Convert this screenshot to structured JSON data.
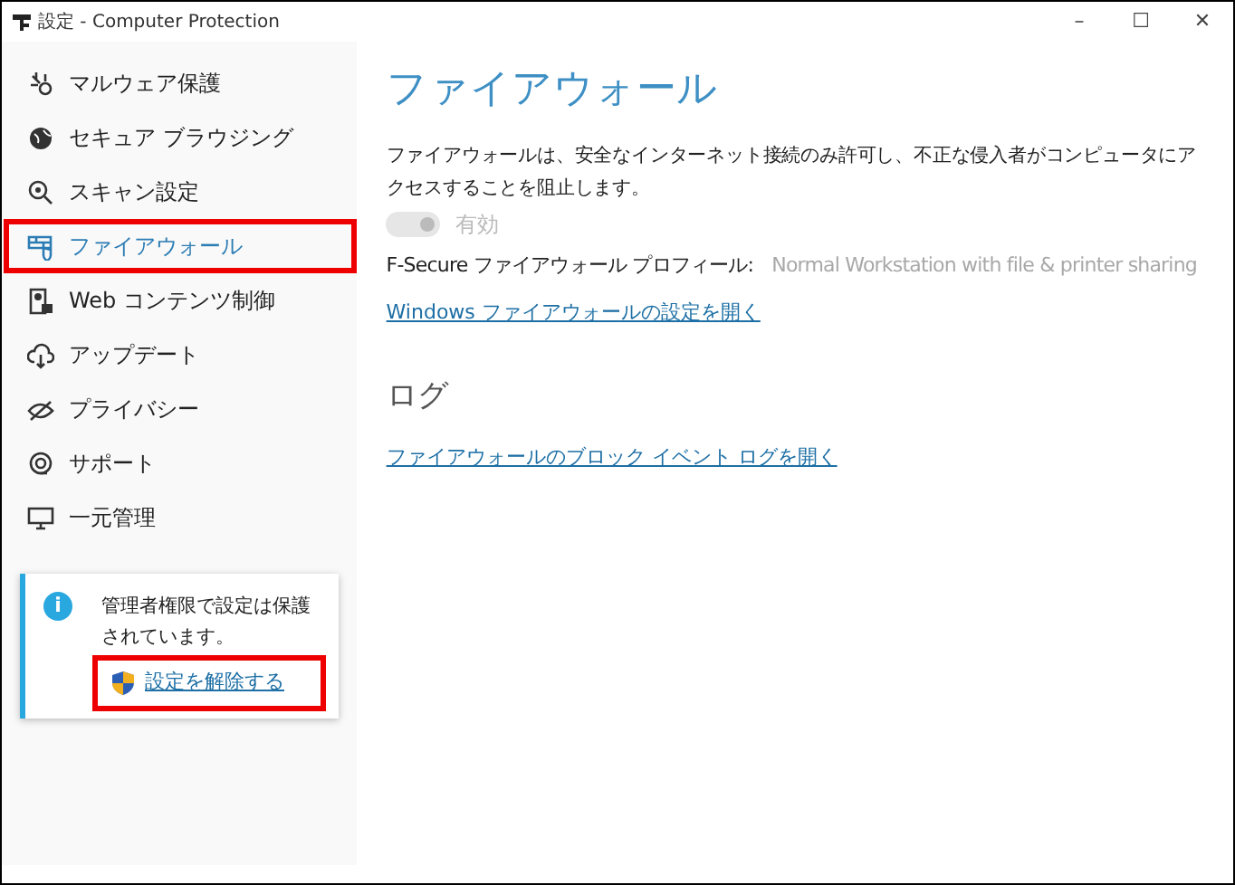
{
  "window": {
    "title": "設定 - Computer Protection",
    "controls": [
      "–",
      "☐",
      "✕"
    ]
  },
  "sidebar": {
    "items": [
      {
        "label": "マルウェア保護",
        "selected": false,
        "highlighted": false
      },
      {
        "label": "セキュア ブラウジング",
        "selected": false,
        "highlighted": false
      },
      {
        "label": "スキャン設定",
        "selected": false,
        "highlighted": false
      },
      {
        "label": "ファイアウォール",
        "selected": true,
        "highlighted": true
      },
      {
        "label": "Web コンテンツ制御",
        "selected": false,
        "highlighted": false
      },
      {
        "label": "アップデート",
        "selected": false,
        "highlighted": false
      },
      {
        "label": "プライバシー",
        "selected": false,
        "highlighted": false
      },
      {
        "label": "サポート",
        "selected": false,
        "highlighted": false
      },
      {
        "label": "一元管理",
        "selected": false,
        "highlighted": false
      }
    ],
    "notice": {
      "icon": "i",
      "text": "管理者権限で設定は保護されています。",
      "link": "設定を解除する",
      "highlighted": true
    }
  },
  "main": {
    "title": "ファイアウォール",
    "description": "ファイアウォールは、安全なインターネット接続のみ許可し、不正な侵入者がコンピュータにアクセスすることを阻止します。",
    "toggle": {
      "label": "有効",
      "on": true,
      "disabled": true
    },
    "profile": {
      "label": "F-Secure ファイアウォール プロフィール:",
      "value": "Normal Workstation with file & printer sharing"
    },
    "link": "Windows ファイアウォールの設定を開く",
    "log": {
      "title": "ログ",
      "link": "ファイアウォールのブロック イベント ログを開く"
    }
  }
}
